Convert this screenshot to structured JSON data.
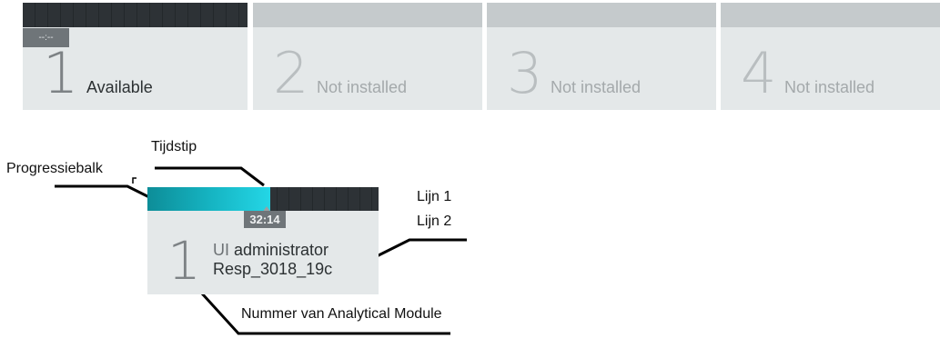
{
  "status_strip": {
    "modules": [
      {
        "number": "1",
        "status": "Available",
        "time": "--:--"
      },
      {
        "number": "2",
        "status": "Not installed"
      },
      {
        "number": "3",
        "status": "Not installed"
      },
      {
        "number": "4",
        "status": "Not installed"
      }
    ]
  },
  "detail_module": {
    "number": "1",
    "time": "32:14",
    "progress": 0.53,
    "line1_prefix": "UI",
    "line1_user": "administrator",
    "line2": "Resp_3018_19c"
  },
  "annotations": {
    "time": "Tijdstip",
    "progress": "Progressiebalk",
    "line1": "Lijn 1",
    "line2": "Lijn 2",
    "module_number": "Nummer van Analytical Module"
  },
  "colors": {
    "progress_fill": "#15b3c1",
    "bar_dark": "#2d3236",
    "tile_bg": "#e4e8e9"
  }
}
